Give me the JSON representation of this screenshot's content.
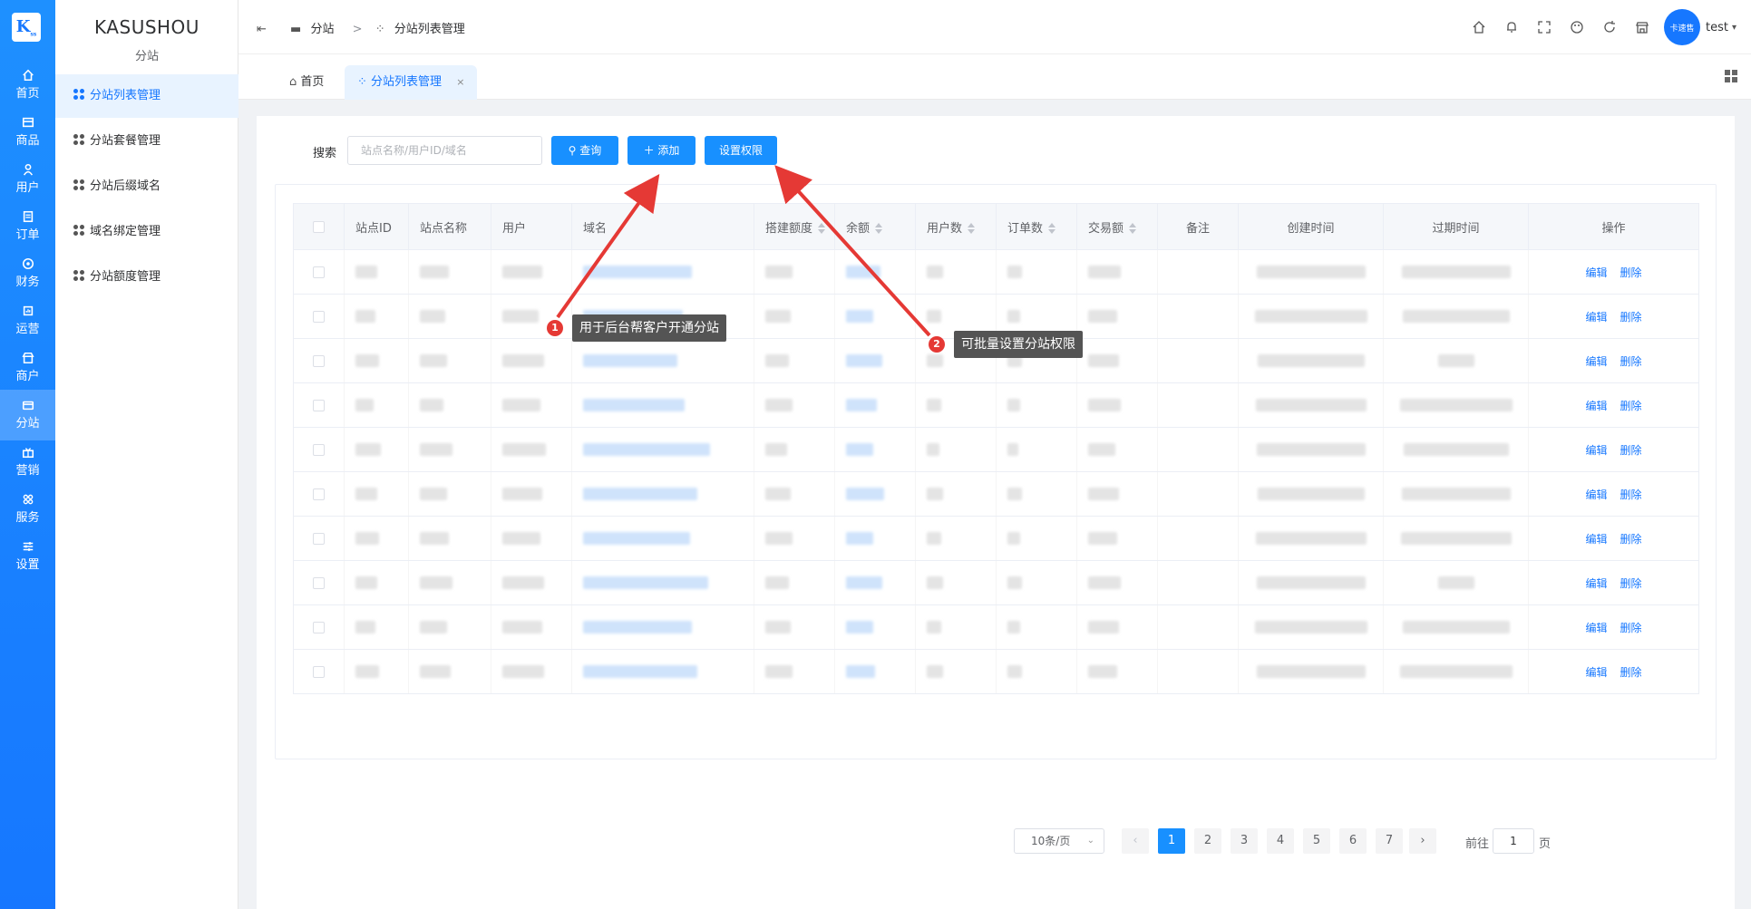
{
  "rail": {
    "logo": "K",
    "items": [
      {
        "label": "首页",
        "icon": "home-icon"
      },
      {
        "label": "商品",
        "icon": "goods-icon"
      },
      {
        "label": "用户",
        "icon": "user-icon"
      },
      {
        "label": "订单",
        "icon": "order-icon"
      },
      {
        "label": "财务",
        "icon": "finance-icon"
      },
      {
        "label": "运营",
        "icon": "operation-icon"
      },
      {
        "label": "商户",
        "icon": "merchant-icon"
      },
      {
        "label": "分站",
        "icon": "substation-icon"
      },
      {
        "label": "营销",
        "icon": "marketing-icon"
      },
      {
        "label": "服务",
        "icon": "service-icon"
      },
      {
        "label": "设置",
        "icon": "settings-icon"
      }
    ],
    "active_index": 7
  },
  "subnav": {
    "brand": "KASUSHOU",
    "section": "分站",
    "items": [
      "分站列表管理",
      "分站套餐管理",
      "分站后缀域名",
      "域名绑定管理",
      "分站额度管理"
    ]
  },
  "header": {
    "breadcrumb": [
      "分站",
      "分站列表管理"
    ],
    "separator": ">",
    "avatar_text": "卡速售",
    "username": "test"
  },
  "tabs": {
    "home": "首页",
    "current": "分站列表管理",
    "close": "×"
  },
  "toolbar": {
    "search_label": "搜索",
    "search_placeholder": "站点名称/用户ID/域名",
    "query_label": "查询",
    "add_label": "添加",
    "perm_label": "设置权限"
  },
  "table": {
    "columns": [
      "站点ID",
      "站点名称",
      "用户",
      "域名",
      "搭建额度",
      "余额",
      "用户数",
      "订单数",
      "交易额",
      "备注",
      "创建时间",
      "过期时间",
      "操作"
    ],
    "sortable": [
      "搭建额度",
      "余额",
      "用户数",
      "订单数",
      "交易额"
    ],
    "row_count": 10,
    "edit_label": "编辑",
    "delete_label": "删除"
  },
  "pagination": {
    "page_size": "10条/页",
    "pages": [
      "1",
      "2",
      "3",
      "4",
      "5",
      "6",
      "7"
    ],
    "current_page": "1",
    "prev": "‹",
    "next": "›",
    "goto_label": "前往",
    "goto_value": "1",
    "page_suffix": "页"
  },
  "annotations": [
    {
      "num": "1",
      "text": "用于后台帮客户开通分站"
    },
    {
      "num": "2",
      "text": "可批量设置分站权限"
    }
  ],
  "colors": {
    "primary": "#1890ff",
    "rail": "#1677ff",
    "annotation_bg": "#545454",
    "badge": "#e53935"
  }
}
